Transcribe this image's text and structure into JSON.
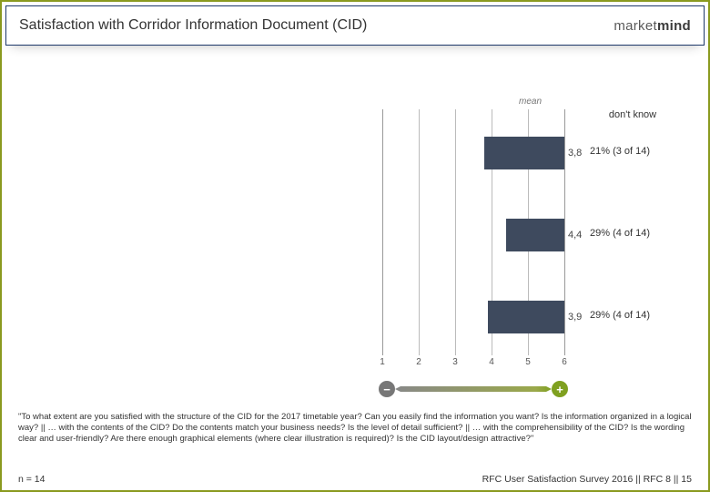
{
  "header": {
    "title": "Satisfaction with Corridor Information Document (CID)",
    "logo_prefix": "market",
    "logo_suffix": "mind"
  },
  "chart_data": {
    "type": "bar",
    "orientation": "horizontal",
    "xlabel": "",
    "ylabel": "",
    "xlim": [
      1,
      6
    ],
    "ticks": [
      1,
      2,
      3,
      4,
      5,
      6
    ],
    "mean_label": "mean",
    "series": [
      {
        "value": 3.8,
        "label": "3,8",
        "dont_know": "21% (3 of 14)"
      },
      {
        "value": 4.4,
        "label": "4,4",
        "dont_know": "29% (4 of 14)"
      },
      {
        "value": 3.9,
        "label": "3,9",
        "dont_know": "29% (4 of 14)"
      }
    ],
    "dont_know_header": "don't know",
    "scale_arrow": {
      "minus": "−",
      "plus": "+"
    }
  },
  "question_text": "\"To what extent are you satisfied with the structure of the CID for the 2017 timetable year? Can you easily find the information you want? Is the information organized in a logical way? || … with the contents of the CID? Do the contents match your business needs? Is the level of detail sufficient? || … with the comprehensibility of the CID? Is the wording clear and user-friendly? Are there enough graphical elements (where clear illustration is required)? Is the CID layout/design attractive?\"",
  "footer": {
    "n_label": "n = 14",
    "source": "RFC User Satisfaction Survey 2016 || RFC 8 || 15"
  }
}
